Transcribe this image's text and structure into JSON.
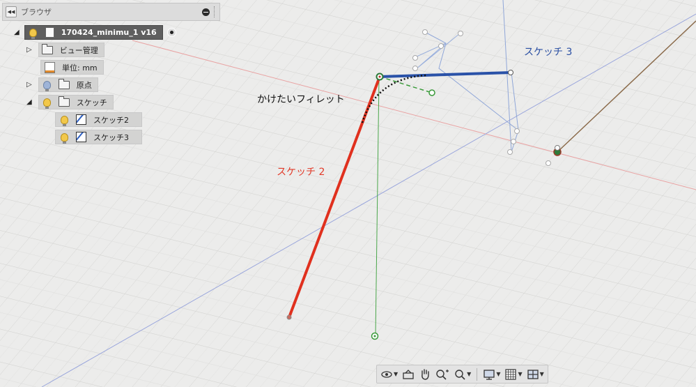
{
  "browser": {
    "title": "ブラウザ",
    "tree": [
      {
        "label": "170424_minimu_1 v16"
      },
      {
        "label": "ビュー管理"
      },
      {
        "label": "単位: mm"
      },
      {
        "label": "原点"
      },
      {
        "label": "スケッチ"
      },
      {
        "label": "スケッチ2"
      },
      {
        "label": "スケッチ3"
      }
    ]
  },
  "canvas": {
    "fillet_label": "かけたいフィレット",
    "sketch2_label": "スケッチ 2",
    "sketch3_label": "スケッチ 3"
  },
  "colors": {
    "sketch2_line": "#e0301e",
    "sketch3_line": "#2a52a8",
    "sketch2_text": "#e23b2a",
    "sketch3_text": "#2a4fa3",
    "axis_red": "#e8a0a0",
    "axis_blue": "#8f9fd8",
    "axis_green": "#3a9a3a"
  },
  "toolbar": {
    "icons": [
      "orbit-icon",
      "look-at-icon",
      "pan-hand-icon",
      "zoom-icon",
      "fit-icon",
      "display-settings-icon",
      "grid-settings-icon",
      "viewports-icon"
    ]
  }
}
